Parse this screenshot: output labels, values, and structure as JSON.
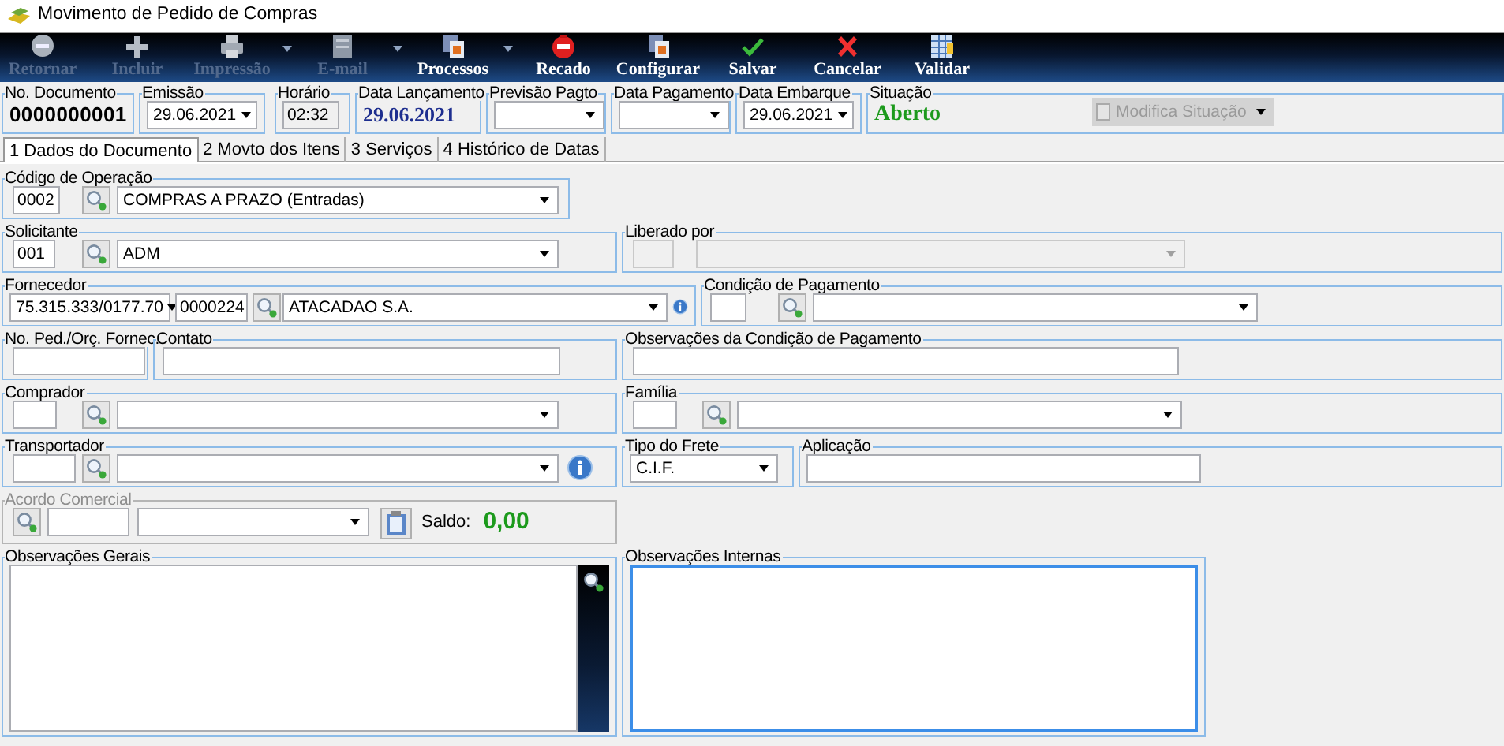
{
  "window": {
    "title": "Movimento de Pedido de Compras"
  },
  "toolbar": [
    {
      "label": "Retornar",
      "disabled": true,
      "dropdown": false
    },
    {
      "label": "Incluir",
      "disabled": true,
      "dropdown": false
    },
    {
      "label": "Impressão",
      "disabled": true,
      "dropdown": true
    },
    {
      "label": "E-mail",
      "disabled": true,
      "dropdown": true
    },
    {
      "label": "Processos",
      "disabled": false,
      "dropdown": true
    },
    {
      "label": "Recado",
      "disabled": false,
      "dropdown": false
    },
    {
      "label": "Configurar",
      "disabled": false,
      "dropdown": false
    },
    {
      "label": "Salvar",
      "disabled": false,
      "dropdown": false
    },
    {
      "label": "Cancelar",
      "disabled": false,
      "dropdown": false
    },
    {
      "label": "Validar",
      "disabled": false,
      "dropdown": false
    }
  ],
  "header": [
    {
      "label": "No. Documento",
      "kind": "number",
      "value": "0000000001"
    },
    {
      "label": "Emissão",
      "kind": "date_select",
      "value": "29.06.2021"
    },
    {
      "label": "Horário",
      "kind": "time",
      "value": "02:32"
    },
    {
      "label": "Data Lançamento",
      "kind": "date",
      "value": "29.06.2021"
    },
    {
      "label": "Previsão Pagto",
      "kind": "select"
    },
    {
      "label": "Data Pagamento",
      "kind": "select"
    },
    {
      "label": "Data Embarque",
      "kind": "date_select",
      "value": "29.06.2021"
    },
    {
      "label": "Situação",
      "kind": "status",
      "value": "Aberto"
    }
  ],
  "modify_button": {
    "label": "Modifica Situação",
    "disabled": true
  },
  "tabs": [
    {
      "label": "1 Dados do Documento",
      "selected": true
    },
    {
      "label": "2 Movto dos Itens",
      "selected": false
    },
    {
      "label": "3 Serviços",
      "selected": false
    },
    {
      "label": "4 Histórico de Datas",
      "selected": false
    }
  ],
  "form": [
    [
      {
        "label": "Código de Operação",
        "disabled": false,
        "controls": [
          {
            "kind": "input",
            "value": "0002",
            "disabled": false
          },
          {
            "kind": "lookup"
          },
          {
            "kind": "select",
            "value": "COMPRAS A PRAZO (Entradas)",
            "disabled": false
          }
        ]
      }
    ],
    [
      {
        "label": "Solicitante",
        "disabled": false,
        "controls": [
          {
            "kind": "input",
            "value": "001",
            "disabled": false
          },
          {
            "kind": "lookup"
          },
          {
            "kind": "select",
            "value": "ADM",
            "disabled": false
          }
        ]
      },
      {
        "label": "Liberado por",
        "disabled": false,
        "controls": [
          {
            "kind": "input",
            "disabled": true
          },
          {
            "kind": "select",
            "disabled": true
          }
        ]
      }
    ],
    [
      {
        "label": "Fornecedor",
        "disabled": false,
        "controls": [
          {
            "kind": "select",
            "value": "75.315.333/0177.70",
            "disabled": false
          },
          {
            "kind": "input",
            "value": "0000224",
            "disabled": false
          },
          {
            "kind": "lookup"
          },
          {
            "kind": "select",
            "value": "ATACADAO S.A.",
            "disabled": false
          },
          {
            "kind": "info"
          }
        ]
      },
      {
        "label": "Condição de Pagamento",
        "disabled": false,
        "controls": [
          {
            "kind": "input",
            "disabled": false
          },
          {
            "kind": "lookup"
          },
          {
            "kind": "select",
            "disabled": false
          }
        ]
      }
    ],
    [
      {
        "label": "No. Ped./Orç. Fornec.",
        "disabled": false,
        "controls": [
          {
            "kind": "input",
            "disabled": false
          }
        ]
      },
      {
        "label": "Contato",
        "disabled": false,
        "controls": [
          {
            "kind": "input",
            "disabled": false
          }
        ]
      },
      {
        "label": "Observações da Condição de Pagamento",
        "disabled": false,
        "controls": [
          {
            "kind": "input",
            "disabled": false
          }
        ]
      }
    ],
    [
      {
        "label": "Comprador",
        "disabled": false,
        "controls": [
          {
            "kind": "input",
            "disabled": false
          },
          {
            "kind": "lookup"
          },
          {
            "kind": "select",
            "disabled": false
          }
        ]
      },
      {
        "label": "Família",
        "disabled": false,
        "controls": [
          {
            "kind": "input",
            "disabled": false
          },
          {
            "kind": "lookup"
          },
          {
            "kind": "select",
            "disabled": false
          }
        ]
      }
    ],
    [
      {
        "label": "Transportador",
        "disabled": false,
        "controls": [
          {
            "kind": "input",
            "disabled": false
          },
          {
            "kind": "lookup"
          },
          {
            "kind": "select",
            "disabled": false
          },
          {
            "kind": "info"
          }
        ]
      },
      {
        "label": "Tipo do Frete",
        "disabled": false,
        "controls": [
          {
            "kind": "select",
            "value": "C.I.F.",
            "disabled": false
          }
        ]
      },
      {
        "label": "Aplicação",
        "disabled": false,
        "controls": [
          {
            "kind": "input",
            "disabled": false
          }
        ]
      }
    ],
    [
      {
        "label": "Acordo Comercial",
        "disabled": true,
        "controls": [
          {
            "kind": "lookup"
          },
          {
            "kind": "input",
            "disabled": false
          },
          {
            "kind": "select",
            "disabled": false
          },
          {
            "kind": "clipboard"
          },
          {
            "kind": "caption",
            "value": "Saldo:"
          },
          {
            "kind": "amount",
            "value": "0,00"
          }
        ]
      }
    ],
    [
      {
        "label": "Observações Gerais",
        "disabled": false,
        "controls": [
          {
            "kind": "memo",
            "focused": false
          },
          {
            "kind": "side_panel"
          }
        ]
      },
      {
        "label": "Observações Internas",
        "disabled": false,
        "controls": [
          {
            "kind": "memo",
            "focused": true
          }
        ]
      }
    ]
  ]
}
